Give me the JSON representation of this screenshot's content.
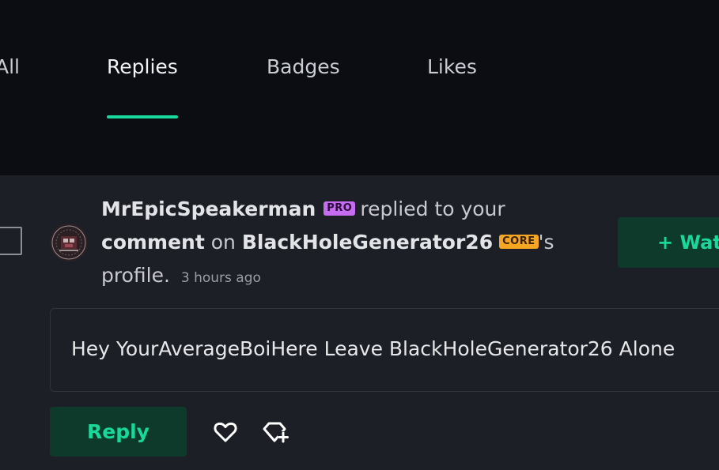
{
  "tabs": [
    {
      "label": "All",
      "active": false
    },
    {
      "label": "Replies",
      "active": true
    },
    {
      "label": "Badges",
      "active": false
    },
    {
      "label": "Likes",
      "active": false
    }
  ],
  "colors": {
    "accent": "#19d89a",
    "pro_badge": "#c56cf0",
    "core_badge": "#f5a623",
    "topbar_bg": "#0b0d12",
    "main_bg": "#1c1f25"
  },
  "notification": {
    "user": "MrEpicSpeakerman",
    "user_badge": "PRO",
    "text_1": "replied to your",
    "target_link": "comment",
    "text_2": "on",
    "profile_user": "BlackHoleGenerator26",
    "profile_badge": "CORE",
    "text_3": "'s",
    "text_4": "profile.",
    "timestamp": "3 hours ago"
  },
  "comment": {
    "body": "Hey YourAverageBoiHere Leave BlackHoleGenerator26 Alone"
  },
  "actions": {
    "reply_label": "Reply",
    "watch_label": "+ Watch",
    "like_icon": "heart-icon",
    "award_icon": "award-plus-icon"
  }
}
